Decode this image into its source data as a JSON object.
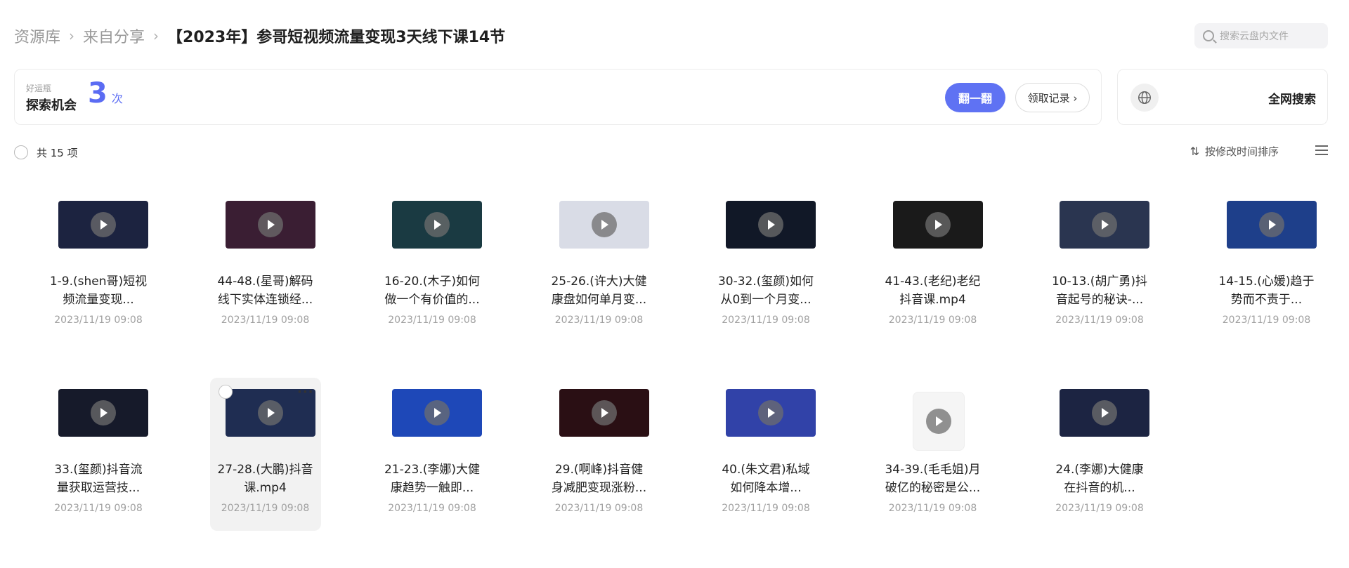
{
  "breadcrumb": {
    "root": "资源库",
    "level2": "来自分享",
    "current": "【2023年】参哥短视频流量变现3天线下课14节"
  },
  "search": {
    "placeholder": "搜索云盘内文件",
    "icon": "search-icon"
  },
  "lucky": {
    "label_small": "好运瓶",
    "label_big": "探索机会",
    "count": "3",
    "unit": "次",
    "flip_label": "翻一翻",
    "record_label": "领取记录 ›"
  },
  "websearch": {
    "label": "全网搜索",
    "icon": "globe-icon"
  },
  "list": {
    "total": "共 15 项",
    "sort_label": "按修改时间排序",
    "sort_icon": "sort-icon",
    "view_icon": "list-view-icon"
  },
  "accent_color": "#5f72f3",
  "files": [
    {
      "name1": "1-9.(shen哥)短视",
      "name2": "频流量变现...",
      "date": "2023/11/19 09:08",
      "thumb": "#1c2340"
    },
    {
      "name1": "44-48.(星哥)解码",
      "name2": "线下实体连锁经...",
      "date": "2023/11/19 09:08",
      "thumb": "#3a1e33"
    },
    {
      "name1": "16-20.(木子)如何",
      "name2": "做一个有价值的...",
      "date": "2023/11/19 09:08",
      "thumb": "#1a3a42"
    },
    {
      "name1": "25-26.(许大)大健",
      "name2": "康盘如何单月变...",
      "date": "2023/11/19 09:08",
      "thumb": "#d9dce6"
    },
    {
      "name1": "30-32.(玺颜)如何",
      "name2": "从0到一个月变...",
      "date": "2023/11/19 09:08",
      "thumb": "#111827"
    },
    {
      "name1": "41-43.(老纪)老纪",
      "name2": "抖音课.mp4",
      "date": "2023/11/19 09:08",
      "thumb": "#1a1a1a"
    },
    {
      "name1": "10-13.(胡广勇)抖",
      "name2": "音起号的秘诀-...",
      "date": "2023/11/19 09:08",
      "thumb": "#2a3550"
    },
    {
      "name1": "14-15.(心媛)趋于",
      "name2": "势而不责于...",
      "date": "2023/11/19 09:08",
      "thumb": "#1e3f8a"
    },
    {
      "name1": "33.(玺颜)抖音流",
      "name2": "量获取运营技...",
      "date": "2023/11/19 09:08",
      "thumb": "#161a2a"
    },
    {
      "name1": "27-28.(大鹏)抖音",
      "name2": "课.mp4",
      "date": "2023/11/19 09:08",
      "thumb": "#1f2d52"
    },
    {
      "name1": "21-23.(李娜)大健",
      "name2": "康趋势一触即...",
      "date": "2023/11/19 09:08",
      "thumb": "#1e48b8"
    },
    {
      "name1": "29.(啊峰)抖音健",
      "name2": "身减肥变现涨粉...",
      "date": "2023/11/19 09:08",
      "thumb": "#2a0f14"
    },
    {
      "name1": "40.(朱文君)私域",
      "name2": "如何降本增...",
      "date": "2023/11/19 09:08",
      "thumb": "#3142a8"
    },
    {
      "name1": "34-39.(毛毛姐)月",
      "name2": "破亿的秘密是公...",
      "date": "2023/11/19 09:08",
      "thumb": ""
    },
    {
      "name1": "24.(李娜)大健康",
      "name2": "在抖音的机...",
      "date": "2023/11/19 09:08",
      "thumb": "#1c2442"
    }
  ]
}
